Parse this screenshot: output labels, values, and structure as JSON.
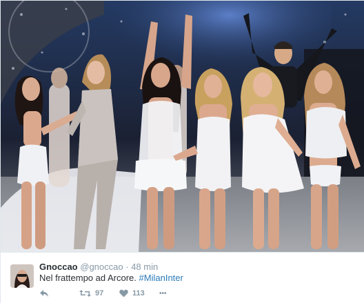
{
  "tweet": {
    "display_name": "Gnoccao",
    "username": "@gnoccao",
    "separator": "·",
    "timestamp": "48 min",
    "text": "Nel frattempo ad Arcore.",
    "hashtag": "#MilanInter",
    "retweet_count": "97",
    "like_count": "113",
    "more_label": "•••"
  },
  "icons": {
    "reply": "reply-icon",
    "retweet": "retweet-icon",
    "like": "heart-icon",
    "more": "more-icon"
  },
  "colors": {
    "text": "#292f33",
    "muted": "#8899a6",
    "link": "#2b7bb9",
    "stage_blue": "#2c4f8c",
    "outfit_white": "#f2f2f4"
  }
}
